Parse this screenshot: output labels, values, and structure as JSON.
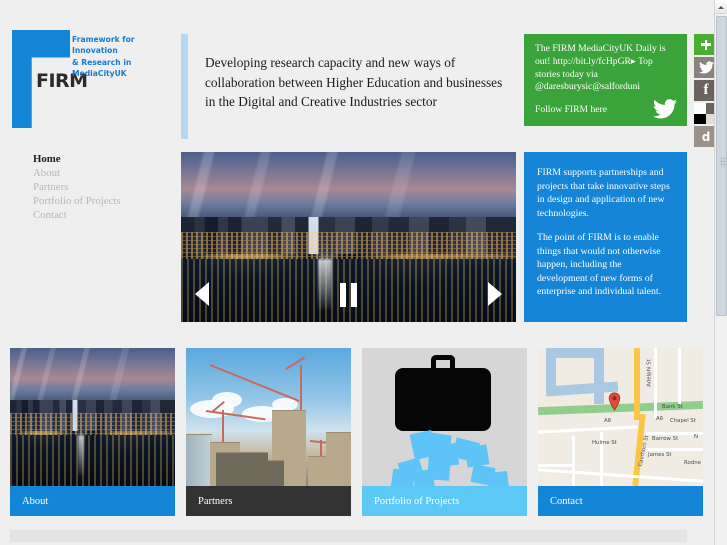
{
  "site": {
    "logo_text": "FIRM",
    "tagline": "Framework for Innovation\n& Research in MediaCityUK",
    "headline": "Developing research capacity and new ways of collaboration between Higher Education and businesses in the Digital and Creative Industries sector"
  },
  "twitter_widget": {
    "status": "The FIRM MediaCityUK Daily is out! http://bit.ly/fcHpGR▸ Top stories today via @daresburysic@salforduni",
    "follow_label": "Follow FIRM here",
    "bg_color": "#3aa43a",
    "bird_icon": "twitter-bird-icon"
  },
  "social_rail": [
    {
      "name": "share-plus-icon",
      "label": "+",
      "color": "#4caf34"
    },
    {
      "name": "twitter-icon",
      "label": "",
      "color": "#8a827c"
    },
    {
      "name": "facebook-icon",
      "label": "f",
      "color": "#6b635e"
    },
    {
      "name": "flickr-icon",
      "label": "",
      "color": "#8a827c"
    },
    {
      "name": "delicious-icon",
      "label": "d",
      "color": "#9a918a"
    }
  ],
  "nav": {
    "items": [
      {
        "label": "Home",
        "active": true
      },
      {
        "label": "About",
        "active": false
      },
      {
        "label": "Partners",
        "active": false
      },
      {
        "label": "Portfolio of Projects",
        "active": false
      },
      {
        "label": "Contact",
        "active": false
      }
    ]
  },
  "carousel": {
    "image_alt": "MediaCityUK waterfront at night",
    "prev_label": "❮",
    "next_label": "❯",
    "pause_label": "pause"
  },
  "info_panel": {
    "accent_color": "#1585d8",
    "paragraph_1": "FIRM supports partnerships and projects that take innovative steps in design and application of new technologies.",
    "paragraph_2": "The point of FIRM is to enable things that would not otherwise happen, including the development of new forms of enterprise and individual talent."
  },
  "cards": [
    {
      "label": "About",
      "label_color": "#1585d8",
      "image": "mediacity-night-photo"
    },
    {
      "label": "Partners",
      "label_color": "#333333",
      "image": "construction-cranes-photo"
    },
    {
      "label": "Portfolio of Projects",
      "label_color": "#5bc8f5",
      "image": "briefcase-illustration"
    },
    {
      "label": "Contact",
      "label_color": "#1585d8",
      "image": "location-map"
    }
  ],
  "map": {
    "streets": [
      "Adelphi St",
      "Bank St",
      "Chapel St",
      "Hulme St",
      "Barrow St",
      "James St",
      "Cavrhorn St",
      "A6",
      "A6",
      "N",
      "Rodne"
    ],
    "marker": "map-pin-marker"
  }
}
